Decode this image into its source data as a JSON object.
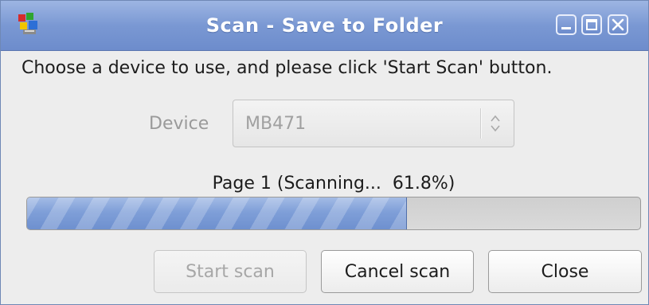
{
  "window": {
    "title": "Scan - Save to Folder",
    "app_icon": "scanner-app-icon",
    "controls": [
      "minimize-icon",
      "maximize-icon",
      "close-icon"
    ]
  },
  "instruction": "Choose a device to use, and please click 'Start Scan' button.",
  "device": {
    "label": "Device",
    "selected": "MB471",
    "enabled": false
  },
  "progress": {
    "label": "Page 1 (Scanning...  61.8%)",
    "fraction": 0.618
  },
  "buttons": {
    "start_scan": "Start scan",
    "cancel_scan": "Cancel scan",
    "close": "Close"
  },
  "colors": {
    "titlebar": "#7a98d3",
    "progress_fill": "#7f9fd8",
    "disabled_text": "#a0a0a0"
  }
}
